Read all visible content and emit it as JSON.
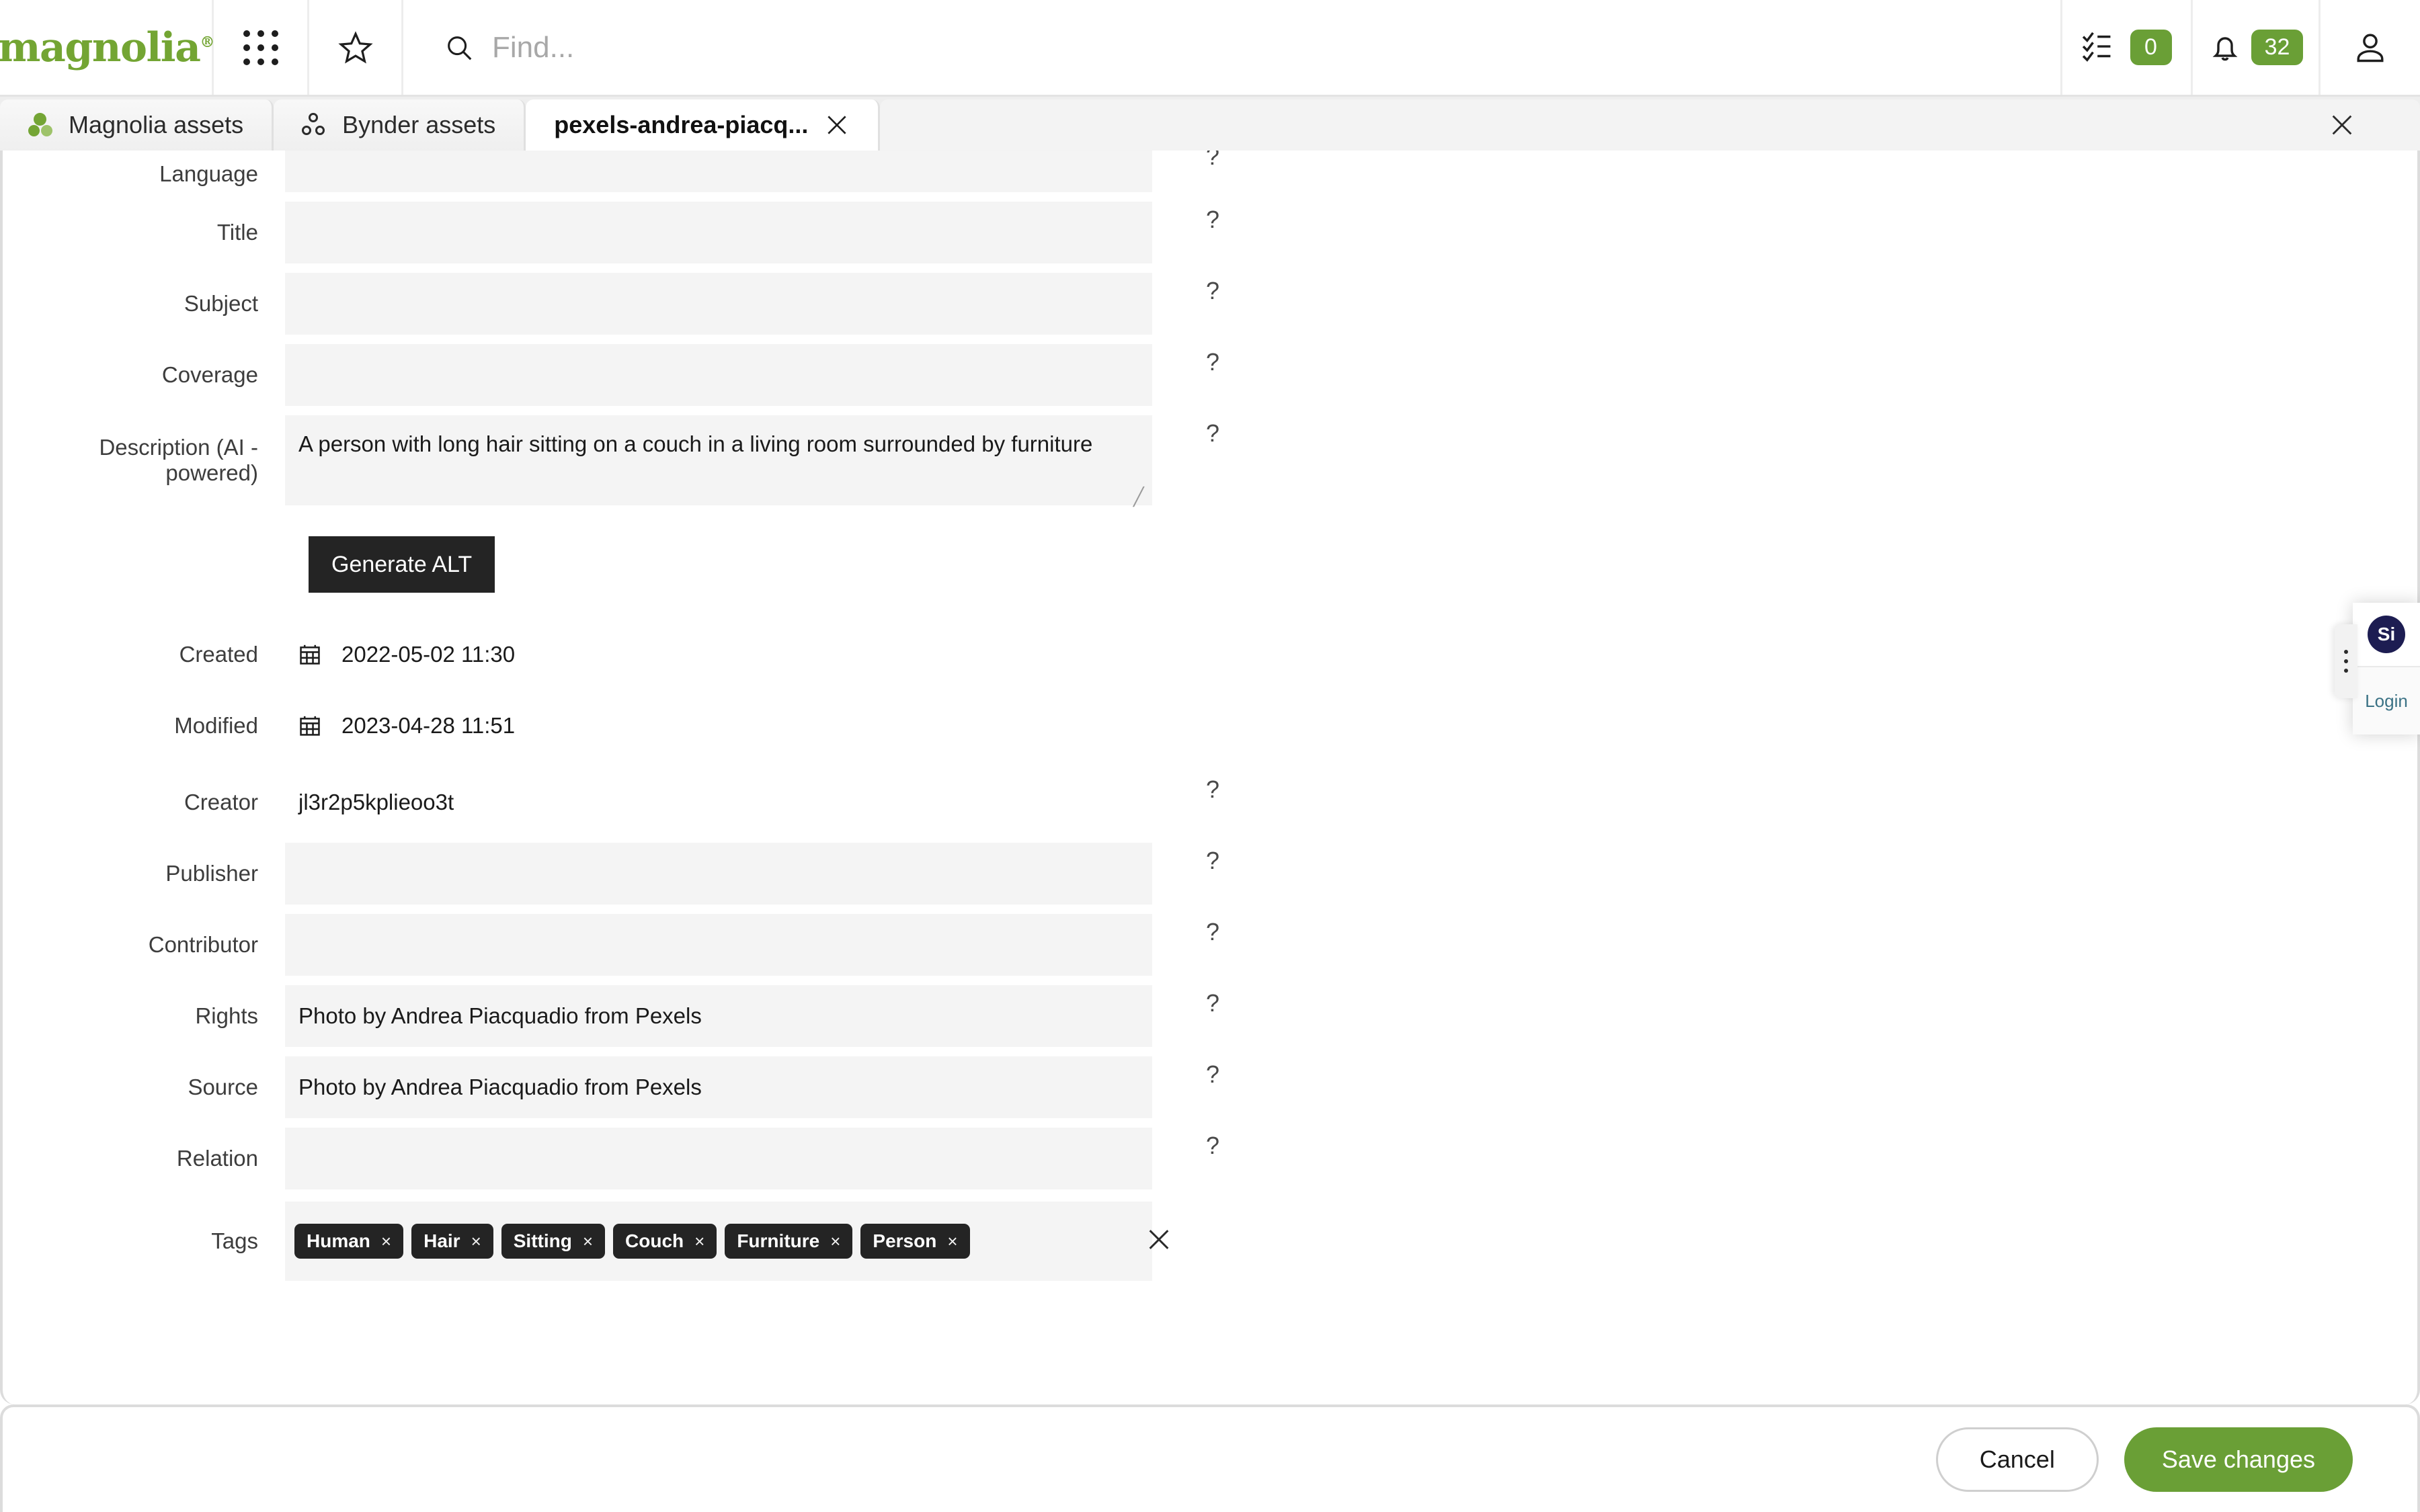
{
  "header": {
    "logo_text": "magnolia",
    "logo_mark": "®",
    "apps_icon": "grid-apps-icon",
    "favorites_icon": "star-icon",
    "search_icon": "search-icon",
    "search_placeholder": "Find...",
    "search_value": "",
    "tasks_icon": "tasks-checklist-icon",
    "tasks_count": "0",
    "notifications_icon": "bell-icon",
    "notifications_count": "32",
    "user_icon": "user-avatar-icon",
    "accent_color": "#6a9f36",
    "logo_color": "#73a533"
  },
  "tabs": [
    {
      "label": "Magnolia assets",
      "icon": "magnolia-dots-icon",
      "active": false,
      "closable": false
    },
    {
      "label": "Bynder assets",
      "icon": "bynder-dots-icon",
      "active": false,
      "closable": false
    },
    {
      "label": "pexels-andrea-piacq...",
      "icon": "",
      "active": true,
      "closable": true
    }
  ],
  "tab_bar": {
    "close_all_icon": "close-icon"
  },
  "form": {
    "help_glyph": "?",
    "fields": [
      {
        "label": "Language",
        "value": "",
        "type": "text",
        "clipped": true
      },
      {
        "label": "Title",
        "value": "",
        "type": "text"
      },
      {
        "label": "Subject",
        "value": "",
        "type": "text"
      },
      {
        "label": "Coverage",
        "value": "",
        "type": "text"
      },
      {
        "label": "Description (AI - powered)",
        "value": "A person with long hair sitting on a couch in a living room surrounded by furniture",
        "type": "textarea"
      }
    ],
    "generate_alt_label": "Generate ALT",
    "dates": [
      {
        "label": "Created",
        "value": "2022-05-02 11:30",
        "icon": "calendar-icon"
      },
      {
        "label": "Modified",
        "value": "2023-04-28 11:51",
        "icon": "calendar-icon"
      }
    ],
    "creator": {
      "label": "Creator",
      "value": "jl3r2p5kplieoo3t"
    },
    "fields2": [
      {
        "label": "Publisher",
        "value": "",
        "type": "text"
      },
      {
        "label": "Contributor",
        "value": "",
        "type": "text"
      },
      {
        "label": "Rights",
        "value": "Photo by Andrea Piacquadio from Pexels",
        "type": "text"
      },
      {
        "label": "Source",
        "value": "Photo by Andrea Piacquadio from Pexels",
        "type": "text"
      },
      {
        "label": "Relation",
        "value": "",
        "type": "text"
      }
    ],
    "tags": {
      "label": "Tags",
      "items": [
        "Human",
        "Hair",
        "Sitting",
        "Couch",
        "Furniture",
        "Person"
      ],
      "chip_remove_glyph": "×",
      "clear_all_icon": "close-icon"
    }
  },
  "footer": {
    "cancel_label": "Cancel",
    "save_label": "Save changes",
    "save_color": "#6a9f36"
  },
  "float_widget": {
    "avatar_initials": "Si",
    "login_label": "Login",
    "avatar_color": "#1d1d52",
    "handle_icon": "drag-handle-icon"
  }
}
